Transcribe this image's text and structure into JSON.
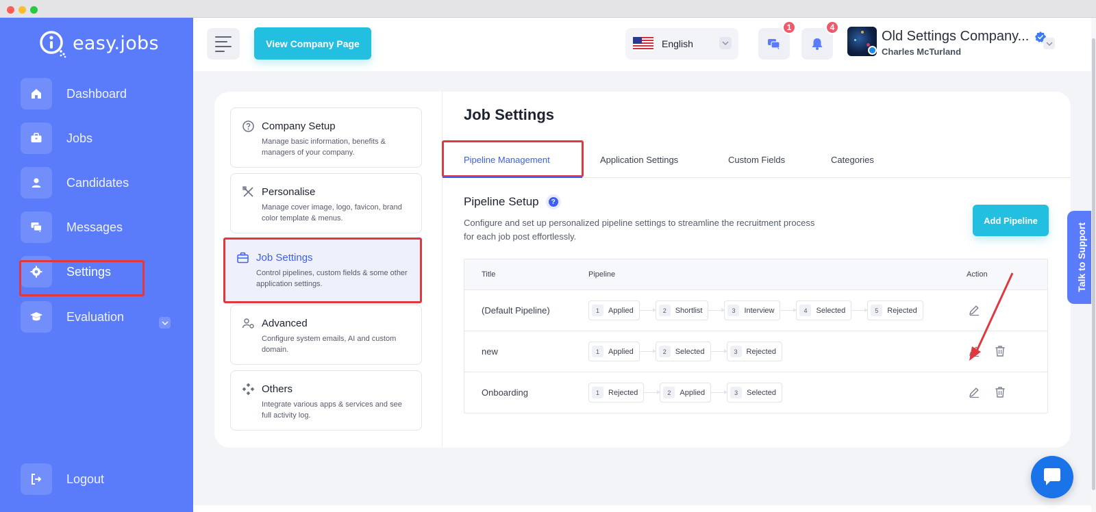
{
  "app": {
    "logo_text": "easy.jobs"
  },
  "sidebar": {
    "items": [
      {
        "label": "Dashboard",
        "icon": "home-icon"
      },
      {
        "label": "Jobs",
        "icon": "briefcase-icon"
      },
      {
        "label": "Candidates",
        "icon": "user-icon"
      },
      {
        "label": "Messages",
        "icon": "chat-icon"
      },
      {
        "label": "Settings",
        "icon": "gear-icon",
        "active": true
      },
      {
        "label": "Evaluation",
        "icon": "graduation-cap-icon"
      }
    ],
    "logout_label": "Logout"
  },
  "header": {
    "view_company_label": "View Company Page",
    "language": "English",
    "messages_badge": "1",
    "notifications_badge": "4",
    "company_name": "Old Settings Company...",
    "user_name": "Charles McTurland"
  },
  "settings_menu": [
    {
      "title": "Company Setup",
      "desc": "Manage basic information, benefits & managers of your company.",
      "icon": "question-circle-icon"
    },
    {
      "title": "Personalise",
      "desc": "Manage cover image, logo, favicon, brand color template & menus.",
      "icon": "design-tools-icon"
    },
    {
      "title": "Job Settings",
      "desc": "Control pipelines, custom fields & some other application settings.",
      "icon": "briefcase-icon",
      "active": true
    },
    {
      "title": "Advanced",
      "desc": "Configure system emails, AI and custom domain.",
      "icon": "user-gear-icon"
    },
    {
      "title": "Others",
      "desc": "Integrate various apps & services and see full activity log.",
      "icon": "apps-icon"
    }
  ],
  "job_settings": {
    "title": "Job Settings",
    "tabs": [
      "Pipeline Management",
      "Application Settings",
      "Custom Fields",
      "Categories"
    ],
    "pipeline_setup_title": "Pipeline Setup",
    "help_glyph": "?",
    "pipeline_setup_desc": "Configure and set up personalized pipeline settings to streamline the recruitment process for each job post effortlessly.",
    "add_pipeline_label": "Add Pipeline",
    "table": {
      "headers": [
        "Title",
        "Pipeline",
        "Action"
      ],
      "rows": [
        {
          "title": "(Default Pipeline)",
          "stages": [
            "Applied",
            "Shortlist",
            "Interview",
            "Selected",
            "Rejected"
          ],
          "deletable": false
        },
        {
          "title": "new",
          "stages": [
            "Applied",
            "Selected",
            "Rejected"
          ],
          "deletable": true
        },
        {
          "title": "Onboarding",
          "stages": [
            "Rejected",
            "Applied",
            "Selected"
          ],
          "deletable": true
        }
      ]
    }
  },
  "support_label": "Talk to Support",
  "colors": {
    "sidebar_bg": "#5b7cfa",
    "accent": "#3d5ef2",
    "cta": "#23bfe0",
    "highlight_red": "#e0383e",
    "badge": "#ef5a6b"
  }
}
